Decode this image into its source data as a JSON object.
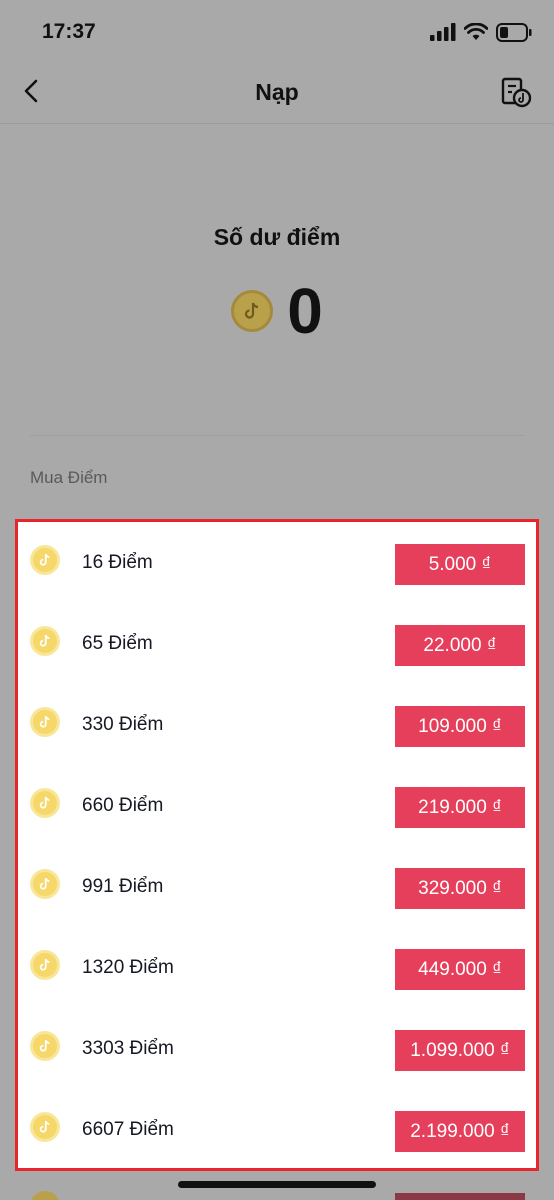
{
  "status_bar": {
    "time": "17:37"
  },
  "header": {
    "title": "Nạp"
  },
  "balance": {
    "label": "Số dư điểm",
    "value": "0"
  },
  "section": {
    "label": "Mua Điểm"
  },
  "packages": [
    {
      "label": "16 Điểm",
      "price": "5.000 ₫"
    },
    {
      "label": "65 Điểm",
      "price": "22.000 ₫"
    },
    {
      "label": "330 Điểm",
      "price": "109.000 ₫"
    },
    {
      "label": "660 Điểm",
      "price": "219.000 ₫"
    },
    {
      "label": "991 Điểm",
      "price": "329.000 ₫"
    },
    {
      "label": "1320 Điểm",
      "price": "449.000 ₫"
    },
    {
      "label": "3303 Điểm",
      "price": "1.099.000 ₫"
    },
    {
      "label": "6607 Điểm",
      "price": "2.199.000 ₫"
    }
  ],
  "icons": {
    "back": "chevron-left-icon",
    "history": "coin-history-icon",
    "coin": "tiktok-coin-icon"
  },
  "colors": {
    "price_button": "#e63f5c",
    "highlight_border": "#e6262b",
    "coin": "#f5d76a",
    "overlay_bg": "#a9a9a9"
  }
}
